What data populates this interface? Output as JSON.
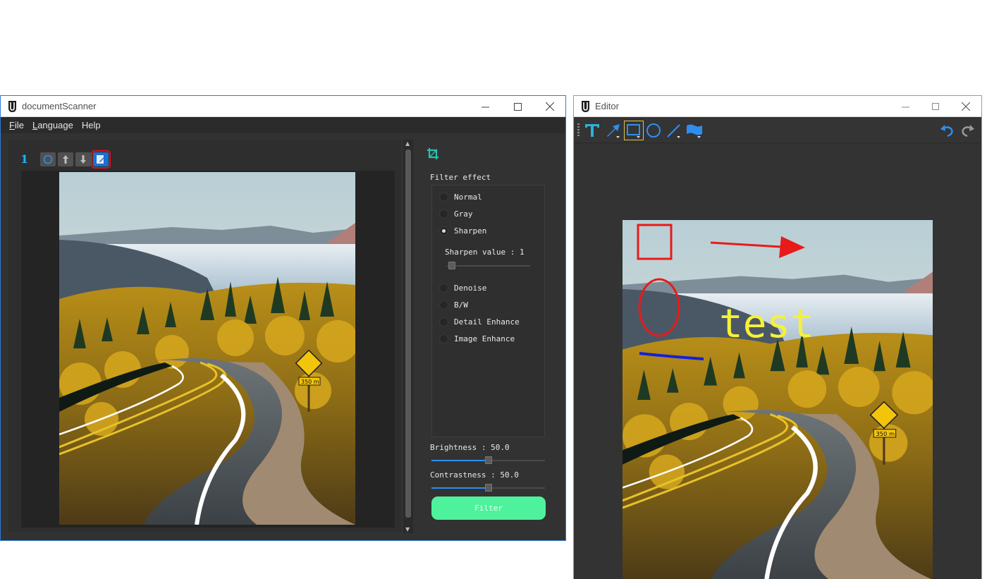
{
  "scanner": {
    "title": "documentScanner",
    "menu": [
      {
        "label": "File",
        "mnemonic": "F",
        "rest": "ile"
      },
      {
        "label": "Language",
        "mnemonic": "L",
        "rest": "anguage"
      },
      {
        "label": "Help",
        "mnemonic": "",
        "rest": "Help"
      }
    ],
    "page_number": "1",
    "panel": {
      "filter_title": "Filter effect",
      "filters": [
        {
          "label": "Normal",
          "selected": false
        },
        {
          "label": "Gray",
          "selected": false
        },
        {
          "label": "Sharpen",
          "selected": true
        },
        {
          "label": "Denoise",
          "selected": false
        },
        {
          "label": "B/W",
          "selected": false
        },
        {
          "label": "Detail Enhance",
          "selected": false
        },
        {
          "label": "Image Enhance",
          "selected": false
        }
      ],
      "sharpen_label": "Sharpen value : 1",
      "sharpen_value": 1,
      "brightness_label": "Brightness : 50.0",
      "brightness_value": 50.0,
      "contrast_label": "Contrastness : 50.0",
      "contrast_value": 50.0,
      "filter_button": "Filter"
    }
  },
  "editor": {
    "title": "Editor",
    "tools": [
      "text-tool-icon",
      "arrow-tool-icon",
      "rectangle-tool-icon",
      "ellipse-tool-icon",
      "line-tool-icon",
      "pen-tool-icon"
    ],
    "selected_tool": "rectangle-tool-icon",
    "annotation_text": "test",
    "colors": {
      "annotation_red": "#e81a1a",
      "annotation_yellow": "#f6f03a",
      "annotation_blue": "#1420d8",
      "accent": "#1fb4ff"
    }
  }
}
